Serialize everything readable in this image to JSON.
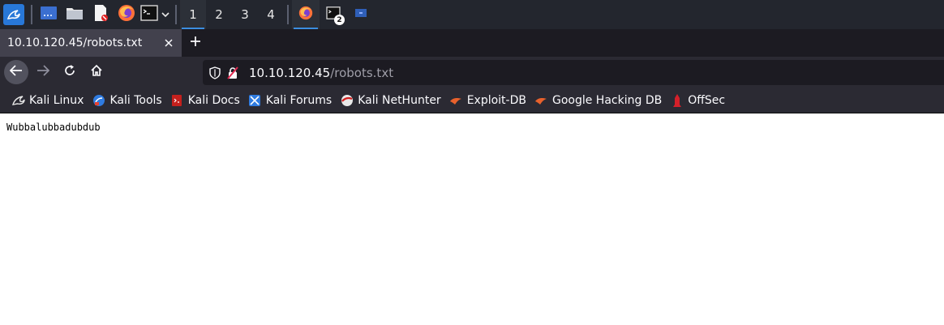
{
  "panel": {
    "workspaces": [
      {
        "label": "1",
        "active": true
      },
      {
        "label": "2",
        "active": false
      },
      {
        "label": "3",
        "active": false
      },
      {
        "label": "4",
        "active": false
      }
    ],
    "launchers": [
      "desktop-icon",
      "file-manager-icon",
      "text-editor-icon",
      "firefox-icon",
      "terminal-icon"
    ],
    "tasks": [
      {
        "icon": "firefox-icon",
        "active": true
      },
      {
        "icon": "terminal-icon",
        "badge": "2"
      },
      {
        "icon": "window-icon"
      }
    ]
  },
  "tabs": [
    {
      "title": "10.10.120.45/robots.txt",
      "active": true
    }
  ],
  "nav": {
    "url_host": "10.10.120.45",
    "url_path": "/robots.txt"
  },
  "bookmarks": [
    {
      "label": "Kali Linux",
      "icon": "kali-dragon-icon"
    },
    {
      "label": "Kali Tools",
      "icon": "kali-tools-icon"
    },
    {
      "label": "Kali Docs",
      "icon": "kali-docs-icon"
    },
    {
      "label": "Kali Forums",
      "icon": "kali-forums-icon"
    },
    {
      "label": "Kali NetHunter",
      "icon": "nethunter-icon"
    },
    {
      "label": "Exploit-DB",
      "icon": "exploit-db-icon"
    },
    {
      "label": "Google Hacking DB",
      "icon": "ghdb-icon"
    },
    {
      "label": "OffSec",
      "icon": "offsec-icon"
    }
  ],
  "page": {
    "text": "Wubbalubbadubdub"
  },
  "colors": {
    "panel_bg": "#23262e",
    "toolbar_bg": "#2b2a33",
    "active_accent": "#3b8ee0"
  }
}
